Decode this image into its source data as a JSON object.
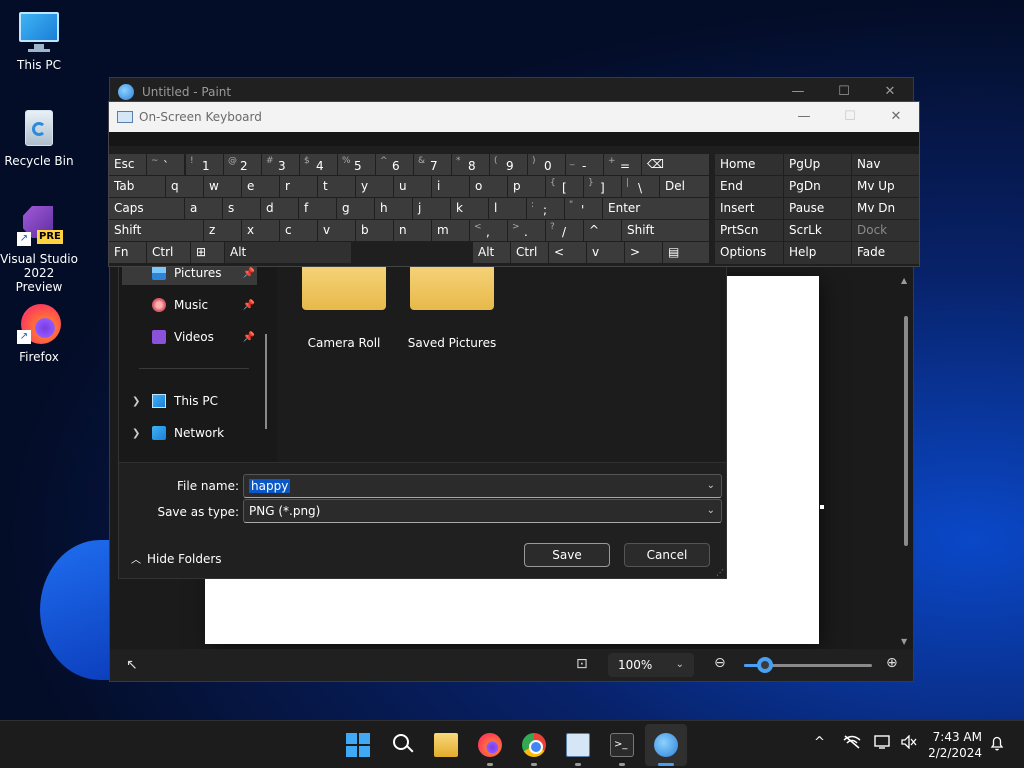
{
  "desktop": {
    "icons": [
      {
        "label": "This PC"
      },
      {
        "label": "Recycle Bin"
      },
      {
        "label": "Visual Studio 2022 Preview",
        "badge": "PRE"
      },
      {
        "label": "Firefox"
      }
    ]
  },
  "paint": {
    "title": "Untitled - Paint",
    "controls": {
      "minimize": "—",
      "maximize": "☐",
      "close": "✕"
    },
    "status": {
      "zoom_value": "100%",
      "zoom_slider_fraction": 0.17
    }
  },
  "osk": {
    "title": "On-Screen Keyboard",
    "controls": {
      "minimize": "—",
      "maximize": "☐",
      "close": "✕"
    },
    "rows": [
      [
        {
          "main": "Esc"
        },
        {
          "sub": "~",
          "main": "`"
        },
        {
          "sub": "!",
          "main": "1"
        },
        {
          "sub": "@",
          "main": "2"
        },
        {
          "sub": "#",
          "main": "3"
        },
        {
          "sub": "$",
          "main": "4"
        },
        {
          "sub": "%",
          "main": "5"
        },
        {
          "sub": "^",
          "main": "6"
        },
        {
          "sub": "&",
          "main": "7"
        },
        {
          "sub": "*",
          "main": "8"
        },
        {
          "sub": "(",
          "main": "9"
        },
        {
          "sub": ")",
          "main": "0"
        },
        {
          "sub": "_",
          "main": "-"
        },
        {
          "sub": "+",
          "main": "="
        },
        {
          "main": "⌫"
        }
      ],
      [
        {
          "main": "Tab"
        },
        {
          "main": "q"
        },
        {
          "main": "w"
        },
        {
          "main": "e"
        },
        {
          "main": "r"
        },
        {
          "main": "t"
        },
        {
          "main": "y"
        },
        {
          "main": "u"
        },
        {
          "main": "i"
        },
        {
          "main": "o"
        },
        {
          "main": "p"
        },
        {
          "sub": "{",
          "main": "["
        },
        {
          "sub": "}",
          "main": "]"
        },
        {
          "sub": "|",
          "main": "\\"
        },
        {
          "main": "Del"
        }
      ],
      [
        {
          "main": "Caps"
        },
        {
          "main": "a"
        },
        {
          "main": "s"
        },
        {
          "main": "d"
        },
        {
          "main": "f"
        },
        {
          "main": "g"
        },
        {
          "main": "h"
        },
        {
          "main": "j"
        },
        {
          "main": "k"
        },
        {
          "main": "l"
        },
        {
          "sub": ":",
          "main": ";"
        },
        {
          "sub": "\"",
          "main": "'"
        },
        {
          "main": "Enter"
        }
      ],
      [
        {
          "main": "Shift"
        },
        {
          "main": "z"
        },
        {
          "main": "x"
        },
        {
          "main": "c"
        },
        {
          "main": "v"
        },
        {
          "main": "b"
        },
        {
          "main": "n"
        },
        {
          "main": "m"
        },
        {
          "sub": "<",
          "main": ","
        },
        {
          "sub": ">",
          "main": "."
        },
        {
          "sub": "?",
          "main": "/"
        },
        {
          "main": "^"
        },
        {
          "main": "Shift"
        }
      ],
      [
        {
          "main": "Fn"
        },
        {
          "main": "Ctrl"
        },
        {
          "main": "⊞"
        },
        {
          "main": "Alt"
        },
        {
          "main": ""
        },
        {
          "main": "Alt"
        },
        {
          "main": "Ctrl"
        },
        {
          "main": "<"
        },
        {
          "main": "v"
        },
        {
          "main": ">"
        },
        {
          "main": "▤"
        }
      ]
    ],
    "nav_keys": [
      [
        "Home",
        "PgUp",
        "Nav"
      ],
      [
        "End",
        "PgDn",
        "Mv Up"
      ],
      [
        "Insert",
        "Pause",
        "Mv Dn"
      ],
      [
        "PrtScn",
        "ScrLk",
        "Dock"
      ],
      [
        "Options",
        "Help",
        "Fade"
      ]
    ]
  },
  "save_dialog": {
    "nav": [
      {
        "label": "Pictures",
        "icon": "pictures-icon"
      },
      {
        "label": "Music",
        "icon": "music-icon"
      },
      {
        "label": "Videos",
        "icon": "videos-icon"
      },
      {
        "label": "This PC",
        "icon": "this-pc-icon"
      },
      {
        "label": "Network",
        "icon": "network-icon"
      }
    ],
    "folders": [
      {
        "label": "Camera Roll"
      },
      {
        "label": "Saved Pictures"
      }
    ],
    "file_name_label": "File name:",
    "file_name_value": "happy",
    "save_as_type_label": "Save as type:",
    "save_as_type_value": "PNG (*.png)",
    "hide_folders": "Hide Folders",
    "save_button": "Save",
    "cancel_button": "Cancel"
  },
  "taskbar": {
    "apps": [
      "start-icon",
      "search-icon",
      "file-explorer-icon",
      "firefox-icon",
      "chrome-icon",
      "on-screen-keyboard-icon",
      "terminal-icon",
      "paint-icon"
    ],
    "terminal_glyph": ">_",
    "tray": {
      "chevron": "^"
    },
    "time": "7:43 AM",
    "date": "2/2/2024"
  }
}
